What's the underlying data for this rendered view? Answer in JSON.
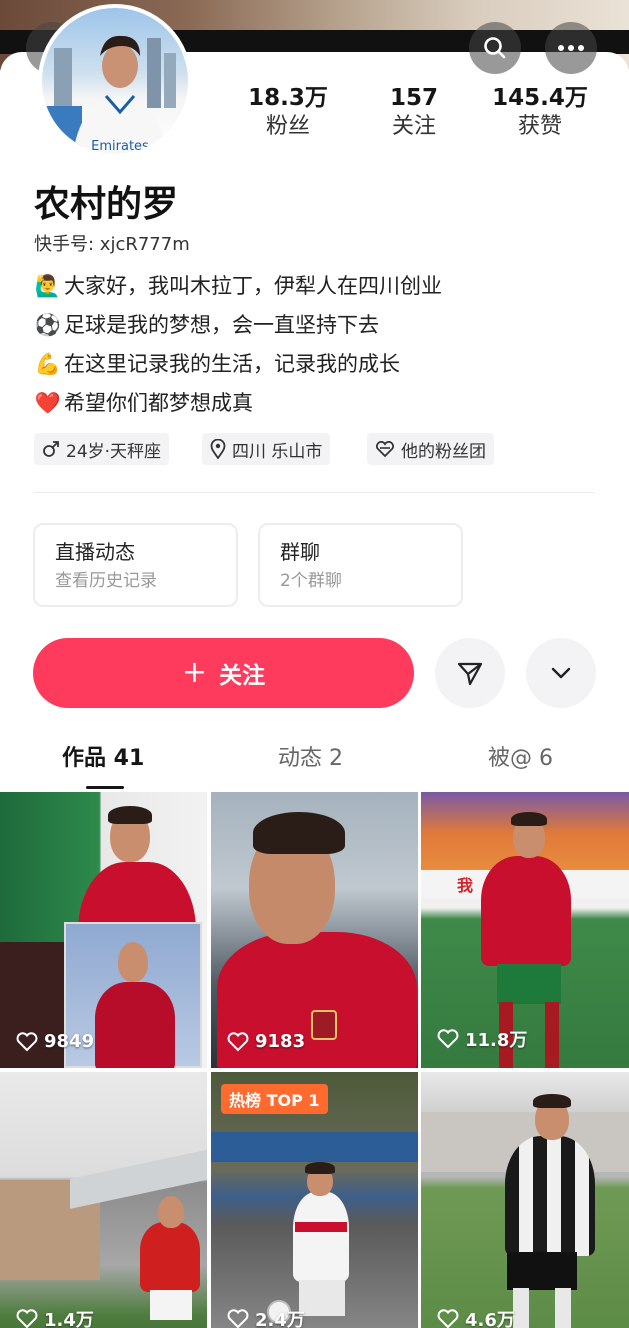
{
  "header": {
    "back_icon": "back-arrow-icon",
    "search_icon": "search-icon",
    "more_icon": "more-dots-icon"
  },
  "profile": {
    "name": "农村的罗",
    "user_id": "快手号: xjcR777m",
    "stats": [
      {
        "value": "18.3万",
        "label": "粉丝"
      },
      {
        "value": "157",
        "label": "关注"
      },
      {
        "value": "145.4万",
        "label": "获赞"
      }
    ],
    "bio": [
      {
        "emoji": "🙋‍♂️",
        "text": "大家好，我叫木拉丁，伊犁人在四川创业"
      },
      {
        "emoji": "⚽",
        "text": "足球是我的梦想，会一直坚持下去"
      },
      {
        "emoji": "💪",
        "text": "在这里记录我的生活，记录我的成长"
      },
      {
        "emoji": "❤️",
        "text": "希望你们都梦想成真"
      }
    ],
    "tags": [
      {
        "icon": "male-icon",
        "text": "24岁·天秤座"
      },
      {
        "icon": "location-pin-icon",
        "text": "四川 乐山市"
      },
      {
        "icon": "fan-club-heart-icon",
        "text": "他的粉丝团"
      }
    ]
  },
  "entries": [
    {
      "title": "直播动态",
      "subtitle": "查看历史记录"
    },
    {
      "title": "群聊",
      "subtitle": "2个群聊"
    }
  ],
  "actions": {
    "follow_label": "关注",
    "share_icon": "send-icon",
    "expand_icon": "chevron-down-icon"
  },
  "tabs": [
    {
      "label": "作品 41",
      "active": true
    },
    {
      "label": "动态 2",
      "active": false
    },
    {
      "label": "被@ 6",
      "active": false
    }
  ],
  "videos": [
    {
      "likes": "9849"
    },
    {
      "likes": "9183"
    },
    {
      "likes": "11.8万"
    },
    {
      "likes": "1.4万"
    },
    {
      "likes": "2.4万",
      "badge": "热榜 TOP 1"
    },
    {
      "likes": "4.6万"
    }
  ],
  "colors": {
    "follow_button": "#fe3a5d",
    "hot_badge": "#ff6a2f",
    "portugal_red": "#c8102e"
  }
}
